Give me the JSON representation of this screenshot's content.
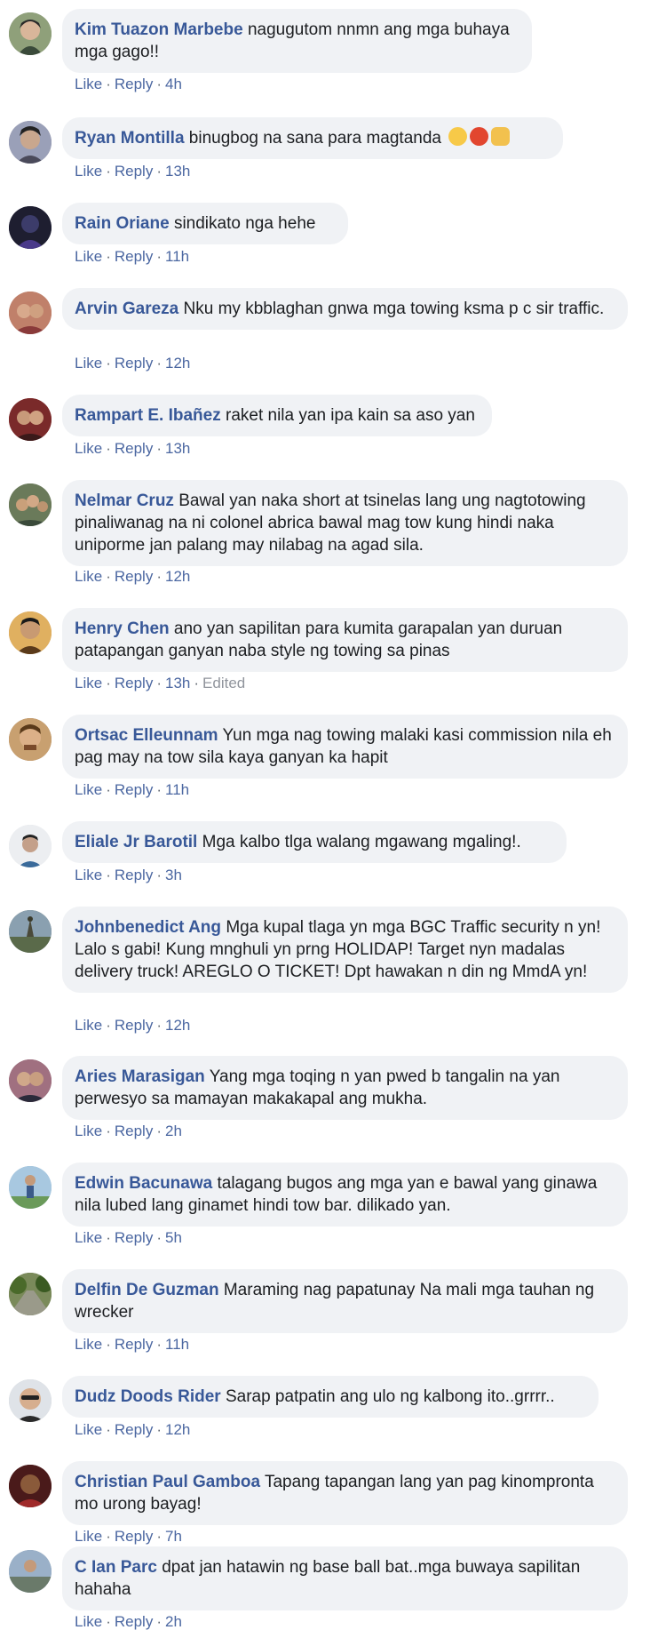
{
  "labels": {
    "like": "Like",
    "reply": "Reply",
    "dot": "·"
  },
  "comments": [
    {
      "author": "Kim Tuazon Marbebe",
      "text": "nagugutom nnmn ang mga buhaya mga gago!!",
      "time": "4h",
      "avatar": "avatar-kim",
      "color": "#7a8a6a"
    },
    {
      "author": "Ryan Montilla",
      "text": "binugbog na sana para magtanda",
      "time": "13h",
      "avatar": "avatar-ryan",
      "color": "#8a7f9a",
      "emoji": [
        "steam-face-emoji",
        "angry-face-emoji",
        "fist-emoji"
      ]
    },
    {
      "author": "Rain Oriane",
      "text": "sindikato nga hehe",
      "time": "11h",
      "avatar": "avatar-rain",
      "color": "#2a2a44"
    },
    {
      "author": "Arvin Gareza",
      "text": "Nku my kbblaghan gnwa mga towing ksma p c sir traffic.",
      "time": "12h",
      "avatar": "avatar-arvin",
      "color": "#b06a5a"
    },
    {
      "author": "Rampart E. Ibañez",
      "text": "raket nila yan ipa kain sa aso yan",
      "time": "13h",
      "avatar": "avatar-rampart",
      "color": "#9a3a3a"
    },
    {
      "author": "Nelmar Cruz",
      "text": "Bawal yan naka short at tsinelas lang ung nagtotowing pinaliwanag na ni colonel abrica bawal mag tow kung hindi naka uniporme jan palang may nilabag na agad sila.",
      "time": "12h",
      "avatar": "avatar-nelmar",
      "color": "#6a7a5a"
    },
    {
      "author": "Henry Chen",
      "text": "ano yan sapilitan para kumita garapalan yan duruan patapangan ganyan naba style ng towing sa pinas",
      "time": "13h",
      "edited": "Edited",
      "avatar": "avatar-henry",
      "color": "#c08a4a"
    },
    {
      "author": "Ortsac Elleunnam",
      "text": "Yun mga nag towing malaki kasi commission nila eh pag may na tow sila kaya ganyan ka hapit",
      "time": "11h",
      "avatar": "avatar-ortsac",
      "color": "#a07a50"
    },
    {
      "author": "Eliale Jr Barotil",
      "text": "Mga kalbo tlga walang mgawang mgaling!.",
      "time": "3h",
      "avatar": "avatar-eliale",
      "color": "#d9dde3"
    },
    {
      "author": "Johnbenedict Ang",
      "text": "Mga kupal tlaga yn mga BGC Traffic security n yn! Lalo s gabi! Kung mnghuli yn prng HOLIDAP! Target nyn madalas delivery truck! AREGLO O TICKET! Dpt hawakan n din ng MmdA yn!",
      "time": "12h",
      "avatar": "avatar-johnbenedict",
      "color": "#5a6a5a"
    },
    {
      "author": "Aries Marasigan",
      "text": "Yang mga toqing n yan pwed b tangalin na yan perwesyo sa mamayan makakapal ang mukha.",
      "time": "2h",
      "avatar": "avatar-aries",
      "color": "#8a5a6a"
    },
    {
      "author": "Edwin Bacunawa",
      "text": "talagang bugos ang mga yan e bawal yang ginawa nila lubed lang ginamet hindi tow bar. dilikado yan.",
      "time": "5h",
      "avatar": "avatar-edwin",
      "color": "#8ab0d0"
    },
    {
      "author": "Delfin De Guzman",
      "text": "Maraming nag papatunay Na mali mga tauhan ng wrecker",
      "time": "11h",
      "avatar": "avatar-delfin",
      "color": "#5a6a3a"
    },
    {
      "author": "Dudz Doods Rider",
      "text": "Sarap patpatin ang ulo ng kalbong ito..grrrr..",
      "time": "12h",
      "avatar": "avatar-dudz",
      "color": "#c0c4c8"
    },
    {
      "author": "Christian Paul Gamboa",
      "text": "Tapang tapangan lang yan pag kinomprontа mo urong bayag!",
      "time": "7h",
      "avatar": "avatar-christian",
      "color": "#6a2a2a"
    },
    {
      "author": "C Ian Parc",
      "text": "dpat jan hatawin ng base ball bat..mga buwaya sapilitan hahaha",
      "time": "2h",
      "avatar": "avatar-cian",
      "color": "#7a90a8"
    }
  ]
}
